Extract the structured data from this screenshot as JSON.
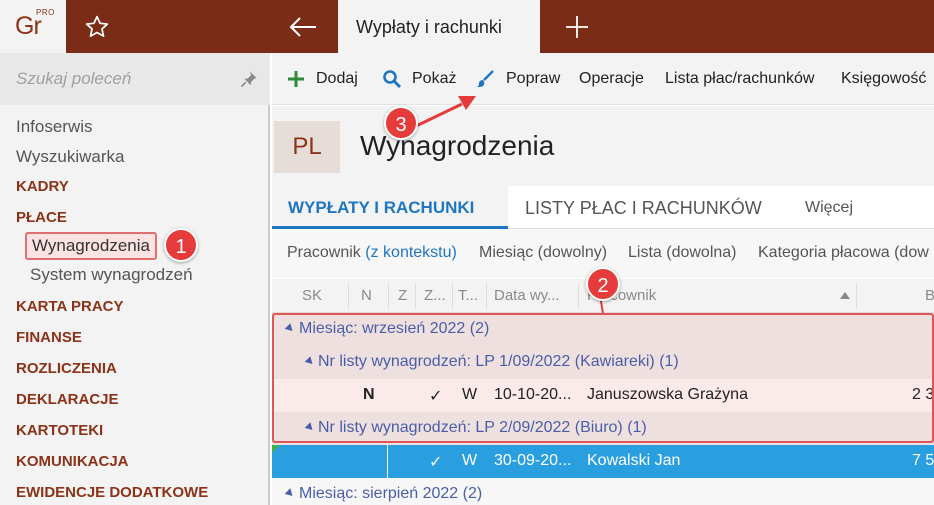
{
  "app": {
    "logo_text": "Gr",
    "logo_badge": "PRO",
    "active_tab": "Wypłaty i rachunki"
  },
  "sidebar": {
    "search_placeholder": "Szukaj poleceń",
    "items": [
      {
        "label": "Infoserwis",
        "kind": "plain"
      },
      {
        "label": "Wyszukiwarka",
        "kind": "plain"
      },
      {
        "label": "KADRY",
        "kind": "section"
      },
      {
        "label": "PŁACE",
        "kind": "section"
      },
      {
        "label": "Wynagrodzenia",
        "kind": "sub-selected"
      },
      {
        "label": "System wynagrodzeń",
        "kind": "sub"
      },
      {
        "label": "KARTA PRACY",
        "kind": "section"
      },
      {
        "label": "FINANSE",
        "kind": "section"
      },
      {
        "label": "ROZLICZENIA",
        "kind": "section"
      },
      {
        "label": "DEKLARACJE",
        "kind": "section"
      },
      {
        "label": "KARTOTEKI",
        "kind": "section"
      },
      {
        "label": "KOMUNIKACJA",
        "kind": "section"
      },
      {
        "label": "EWIDENCJE DODATKOWE",
        "kind": "section"
      }
    ]
  },
  "toolbar": {
    "add_label": "Dodaj",
    "show_label": "Pokaż",
    "edit_label": "Popraw",
    "operations_label": "Operacje",
    "payroll_list_label": "Lista płac/rachunków",
    "accounting_label": "Księgowość"
  },
  "page": {
    "badge": "PL",
    "title": "Wynagrodzenia"
  },
  "tabs": {
    "tab1": "WYPŁATY I RACHUNKI",
    "tab2": "LISTY PŁAC I RACHUNKÓW",
    "more": "Więcej"
  },
  "filters": {
    "employee_label": "Pracownik",
    "employee_value": "(z kontekstu)",
    "month_label": "Miesiąc (dowolny)",
    "list_label": "Lista (dowolna)",
    "category_label": "Kategoria płacowa (dow"
  },
  "grid": {
    "columns": {
      "sk": "SK",
      "n": "N",
      "z": "Z",
      "z2": "Z...",
      "t": "T...",
      "date": "Data wy...",
      "employee": "Pracownik",
      "b": "B"
    },
    "group1": "Miesiąc: wrzesień 2022 (2)",
    "subgroup1": "Nr listy wynagrodzeń: LP 1/09/2022 (Kawiareki) (1)",
    "row1": {
      "n": "N",
      "check": "✓",
      "t": "W",
      "date": "10-10-20...",
      "employee": "Januszowska Grażyna",
      "b": "2 3"
    },
    "subgroup2": "Nr listy wynagrodzeń: LP 2/09/2022 (Biuro) (1)",
    "row2": {
      "check": "✓",
      "t": "W",
      "date": "30-09-20...",
      "employee": "Kowalski Jan",
      "b": "7 5"
    },
    "group2": "Miesiąc: sierpień 2022 (2)"
  },
  "annotations": {
    "step1": "1",
    "step2": "2",
    "step3": "3"
  },
  "colors": {
    "brand": "#7b2c17",
    "accent_blue": "#1f76c0",
    "selection": "#2a9fe0",
    "annotation_red": "#e53b3b"
  },
  "icons": [
    "star-icon",
    "back-arrow-icon",
    "plus-icon",
    "pin-icon",
    "add-plus-icon",
    "search-icon",
    "brush-icon",
    "sort-up-icon",
    "expand-triangle-icon",
    "arrow-annotation"
  ]
}
